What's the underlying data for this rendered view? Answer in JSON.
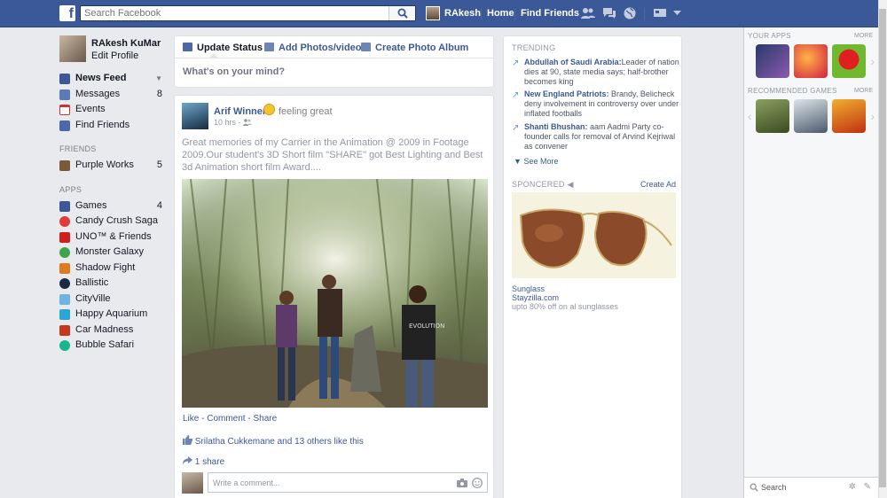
{
  "topbar": {
    "logo": "f",
    "search_placeholder": "Search Facebook",
    "user_name": "RAkesh",
    "home": "Home",
    "find_friends": "Find Friends"
  },
  "left_nav": {
    "profile_name": "RAkesh KuMar",
    "edit_profile": "Edit Profile",
    "main": [
      {
        "label": "News Feed",
        "icon": "news-feed-icon"
      },
      {
        "label": "Messages",
        "count": "8",
        "icon": "messages-icon"
      },
      {
        "label": "Events",
        "icon": "events-icon"
      },
      {
        "label": "Find Friends",
        "icon": "find-friends-icon"
      }
    ],
    "friends_heading": "FRIENDS",
    "friends": [
      {
        "label": "Purple Works",
        "count": "5"
      }
    ],
    "apps_heading": "APPS",
    "apps": [
      {
        "label": "Games",
        "count": "4",
        "color": "#3b5998"
      },
      {
        "label": "Candy Crush Saga",
        "color": "#e23b3b"
      },
      {
        "label": "UNO™ & Friends",
        "color": "#d11f1f"
      },
      {
        "label": "Monster Galaxy",
        "color": "#3fa34d"
      },
      {
        "label": "Shadow  Fight",
        "color": "#e07a1f"
      },
      {
        "label": "Ballistic",
        "color": "#1b2a44"
      },
      {
        "label": "CityVille",
        "color": "#6fb3e0"
      },
      {
        "label": "Happy Aquarium",
        "color": "#2aa7d8"
      },
      {
        "label": "Car Madness",
        "color": "#c8381f"
      },
      {
        "label": "Bubble Safari",
        "color": "#19b58b"
      }
    ]
  },
  "composer": {
    "update_status": "Update Status",
    "add_photos": "Add Photos/video",
    "create_album": "Create Photo Album",
    "placeholder": "What's on your mind?"
  },
  "post": {
    "author": "Arif Winner",
    "feeling": "feeling great",
    "time": "10 hrs -",
    "text": "Great memories  of my Carrier in the  Animation @ 2009 in Footage 2009.Our student's  3D Short film \"SHARE\" got Best Lighting and  Best 3d Animation short film  Award....",
    "actions": "Like - Comment - Share",
    "likes_name": "Srilatha Cukkemane",
    "likes_rest": "and 13 others like this",
    "shares": "1 share",
    "comment_placeholder": "Write a comment..."
  },
  "trending": {
    "heading": "TRENDING",
    "items": [
      {
        "title": "Abdullah of Saudi Arabia:",
        "text": "Leader of nation  dies at 90, state media says; half-brother  becomes king"
      },
      {
        "title": "New England Patriots:",
        "text": " Brandy, Belicheck deny  involvement in controversy over under inflated footballs"
      },
      {
        "title": "Shanti Bhushan:",
        "text": " aam Aadmi Party co-founder calls for removal of Arvind Kejriwal as convener"
      }
    ],
    "see_more": "See More"
  },
  "ad": {
    "heading": "SPONCERED",
    "create_ad": "Create Ad",
    "title": "Sunglass",
    "site": "Stayzilla.com",
    "desc": "upto 80% off on al sunglasses"
  },
  "sidebar": {
    "your_apps": "YOUR APPS",
    "more": "MORE",
    "recommended": "RECOMMENDED GAMES",
    "more2": "MORE",
    "chat_search": "Search"
  }
}
